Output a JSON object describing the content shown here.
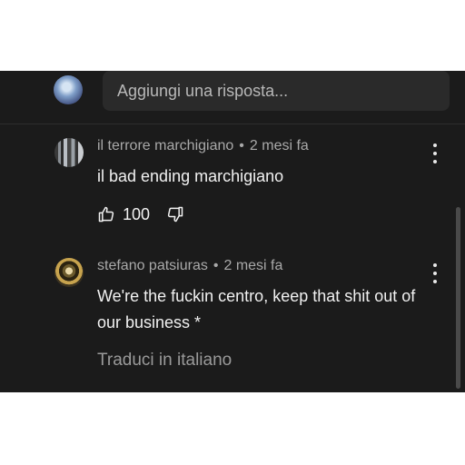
{
  "reply": {
    "placeholder": "Aggiungi una risposta..."
  },
  "comments": [
    {
      "author": "il terrore marchigiano",
      "separator": "•",
      "time": "2 mesi fa",
      "text": "il bad ending marchigiano",
      "likes": "100"
    },
    {
      "author": "stefano patsiuras",
      "separator": "•",
      "time": "2 mesi fa",
      "text": "We're the fuckin centro, keep that shit out of our business *",
      "translate": "Traduci in italiano"
    }
  ],
  "icons": {
    "like": "thumb-up-icon",
    "dislike": "thumb-down-icon",
    "more": "more-vert-icon"
  }
}
